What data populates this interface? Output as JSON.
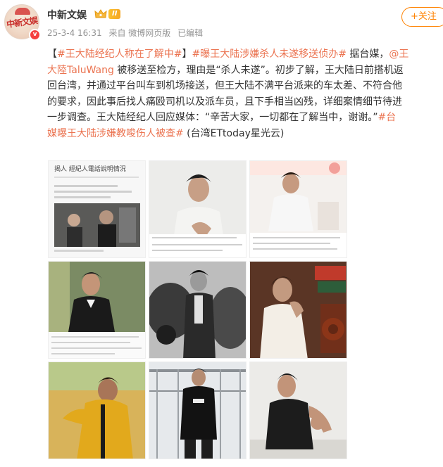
{
  "author": {
    "name": "中新文娱",
    "avatar_text": "中新文娱",
    "level_badge": "II",
    "verified_icon": "verified-v-icon",
    "crown_icon": "crown-icon"
  },
  "meta": {
    "time": "25-3-4 16:31",
    "source": "来自 微博网页版",
    "edited": "已编辑"
  },
  "follow_button": "+关注",
  "post": {
    "lines": [
      [
        {
          "t": "【",
          "link": false
        },
        {
          "t": "#王大陆经纪人称在了解中#",
          "link": true
        },
        {
          "t": "】",
          "link": false
        },
        {
          "t": "#曝王大陆涉嫌杀人未遂移送侦办#",
          "link": true
        },
        {
          "t": " 据台媒，",
          "link": false
        },
        {
          "t": "@王",
          "link": true
        }
      ],
      [
        {
          "t": "大陸TaluWang",
          "link": true
        },
        {
          "t": " 被移送至检方，理由是“杀人未遂”。初步了解，王大陆日前搭机返",
          "link": false
        }
      ],
      [
        {
          "t": "回台湾，并通过平台叫车到机场接送，但王大陆不满平台派来的车太差、不符合他",
          "link": false
        }
      ],
      [
        {
          "t": "的要求，因此事后找人痛殴司机以及派车员，且下手相当凶残，详细案情细节待进",
          "link": false
        }
      ],
      [
        {
          "t": "一步调查。王大陆经纪人回应媒体：“辛苦大家，一切都在了解当中，谢谢。”",
          "link": false
        },
        {
          "t": "#台",
          "link": true
        }
      ],
      [
        {
          "t": "媒曝王大陆涉嫌教唆伤人被查#",
          "link": true
        },
        {
          "t": " (台湾ETtoday星光云)",
          "link": false
        }
      ]
    ]
  },
  "images": [
    {
      "name": "news-screenshot-1",
      "headline": "揭人  經紀人電話說明情況",
      "kind": "news"
    },
    {
      "name": "photo-white-shirt",
      "kind": "portrait"
    },
    {
      "name": "photo-press-event",
      "kind": "event"
    },
    {
      "name": "photo-tuxedo",
      "kind": "tux"
    },
    {
      "name": "photo-bw-car",
      "kind": "bw"
    },
    {
      "name": "photo-vintage-phone",
      "kind": "phone"
    },
    {
      "name": "photo-yellow-jacket",
      "kind": "yellow"
    },
    {
      "name": "photo-black-jacket",
      "kind": "black"
    },
    {
      "name": "photo-tshirt",
      "kind": "tshirt"
    }
  ],
  "colors": {
    "link": "#eb7350",
    "follow": "#ff8200",
    "meta": "#939393",
    "text": "#333333"
  }
}
